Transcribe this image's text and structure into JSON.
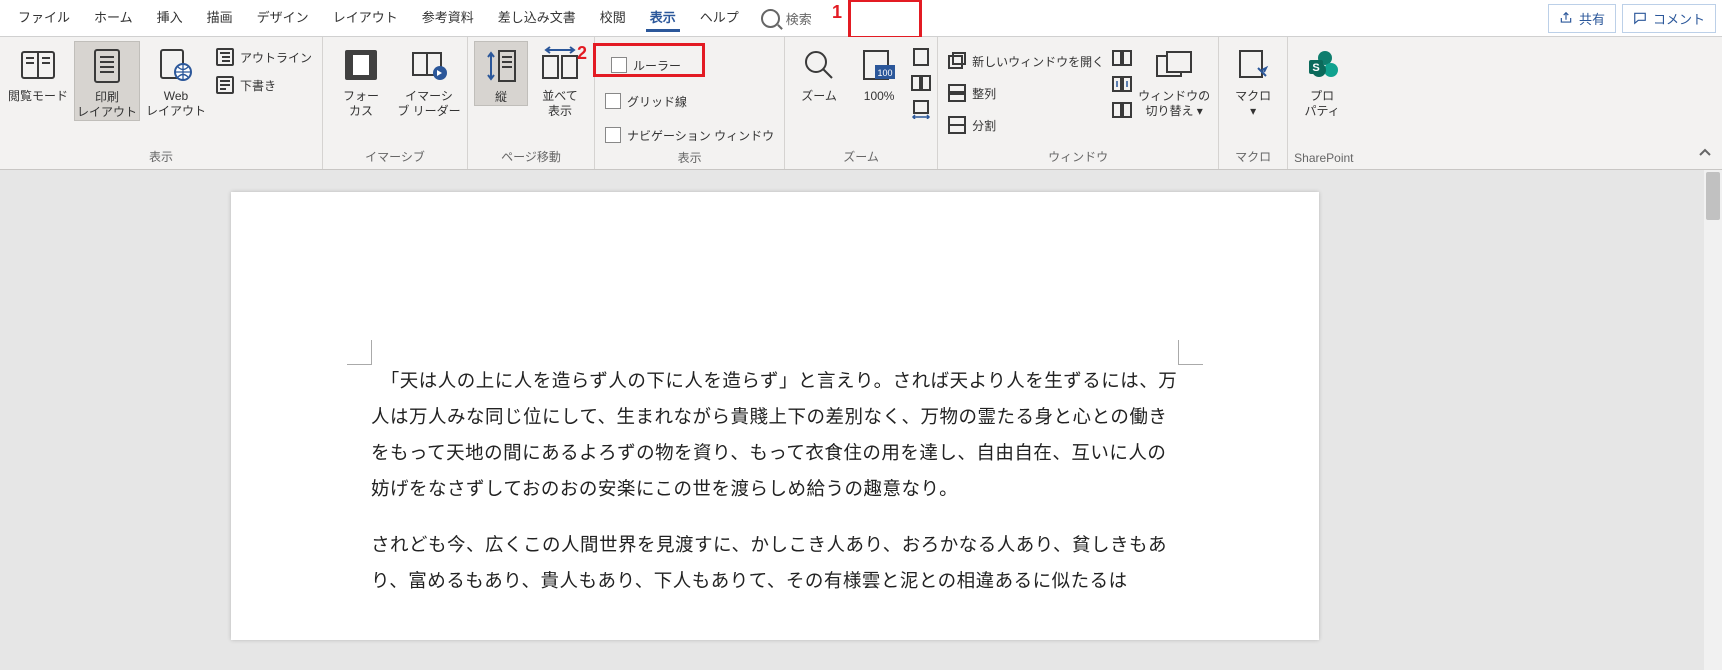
{
  "tabs": {
    "file": "ファイル",
    "home": "ホーム",
    "insert": "挿入",
    "draw": "描画",
    "design": "デザイン",
    "layout": "レイアウト",
    "references": "参考資料",
    "mailings": "差し込み文書",
    "review": "校閲",
    "view": "表示",
    "help": "ヘルプ"
  },
  "search_placeholder": "検索",
  "share_label": "共有",
  "comment_label": "コメント",
  "annotations": {
    "a1": "1",
    "a2": "2"
  },
  "ribbon": {
    "views": {
      "read": "閲覧モード",
      "print_layout_l1": "印刷",
      "print_layout_l2": "レイアウト",
      "web_l1": "Web",
      "web_l2": "レイアウト",
      "outline": "アウトライン",
      "draft": "下書き",
      "group": "表示"
    },
    "immersive": {
      "focus_l1": "フォー",
      "focus_l2": "カス",
      "reader_l1": "イマーシ",
      "reader_l2": "ブ リーダー",
      "group": "イマーシブ"
    },
    "pagemove": {
      "vertical": "縦",
      "side_l1": "並べて",
      "side_l2": "表示",
      "group": "ページ移動"
    },
    "show": {
      "ruler": "ルーラー",
      "gridlines": "グリッド線",
      "navpane": "ナビゲーション ウィンドウ",
      "group": "表示"
    },
    "zoom": {
      "zoom": "ズーム",
      "hundred": "100%",
      "group": "ズーム"
    },
    "window": {
      "new_window": "新しいウィンドウを開く",
      "arrange": "整列",
      "split": "分割",
      "switch_l1": "ウィンドウの",
      "switch_l2": "切り替え",
      "group": "ウィンドウ"
    },
    "macros": {
      "macro_l1": "マクロ",
      "group": "マクロ"
    },
    "sharepoint": {
      "prop_l1": "プロ",
      "prop_l2": "パティ",
      "group": "SharePoint"
    }
  },
  "document": {
    "p1": "　「天は人の上に人を造らず人の下に人を造らず」と言えり。されば天より人を生ずるには、万人は万人みな同じ位にして、生まれながら貴賤上下の差別なく、万物の霊たる身と心との働きをもって天地の間にあるよろずの物を資り、もって衣食住の用を達し、自由自在、互いに人の妨げをなさずしておのおの安楽にこの世を渡らしめ給うの趣意なり。",
    "p2": "されども今、広くこの人間世界を見渡すに、かしこき人あり、おろかなる人あり、貧しきもあり、富めるもあり、貴人もあり、下人もありて、その有様雲と泥との相違あるに似たるは"
  }
}
